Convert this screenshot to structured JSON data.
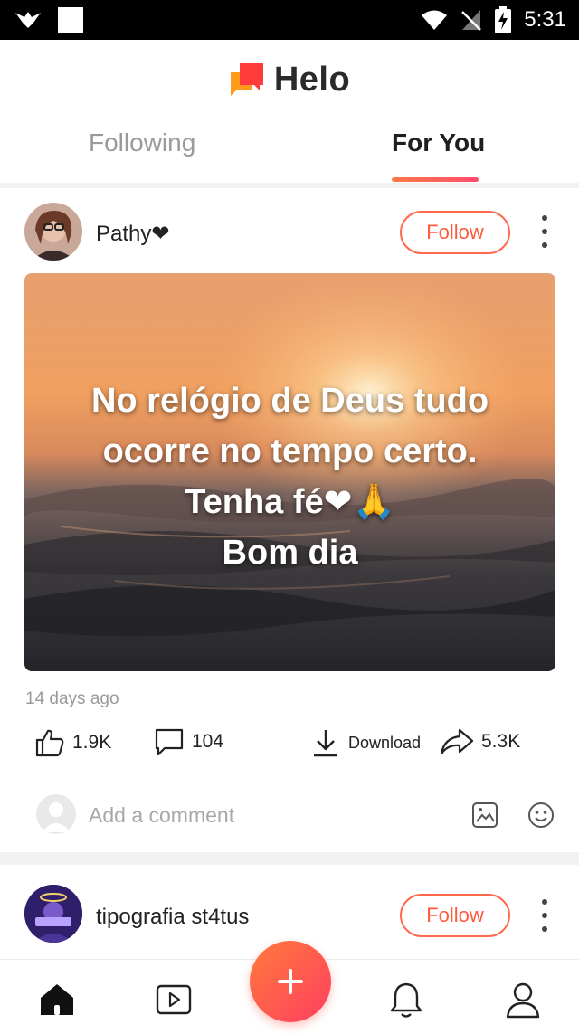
{
  "status_bar": {
    "time": "5:31",
    "icons": [
      "notification-bird-icon",
      "square-icon",
      "wifi-icon",
      "no-signal-icon",
      "battery-charging-icon"
    ]
  },
  "header": {
    "app_title": "Helo",
    "logo_icon": "helo-logo-icon",
    "logo_colors": [
      "#ff7a1a",
      "#ff3b3b"
    ]
  },
  "tabs": [
    {
      "label": "Following",
      "active": false
    },
    {
      "label": "For You",
      "active": true
    }
  ],
  "accent_color": "#ff5a3c",
  "posts": [
    {
      "username": "Pathy❤",
      "follow_label": "Follow",
      "image_text_lines": [
        "No relógio de Deus tudo",
        "ocorre no tempo certo.",
        "Tenha fé❤🙏",
        "Bom dia"
      ],
      "timestamp": "14 days ago",
      "likes": "1.9K",
      "comments": "104",
      "download_label": "Download",
      "shares": "5.3K",
      "comment_placeholder": "Add a comment"
    },
    {
      "username": "tipografia st4tus",
      "follow_label": "Follow"
    }
  ],
  "bottom_nav": [
    {
      "name": "home",
      "icon": "home-icon",
      "active": true
    },
    {
      "name": "video",
      "icon": "video-play-icon",
      "active": false
    },
    {
      "name": "create",
      "icon": "plus-icon",
      "active": false
    },
    {
      "name": "notifications",
      "icon": "bell-icon",
      "active": false
    },
    {
      "name": "profile",
      "icon": "user-icon",
      "active": false
    }
  ]
}
